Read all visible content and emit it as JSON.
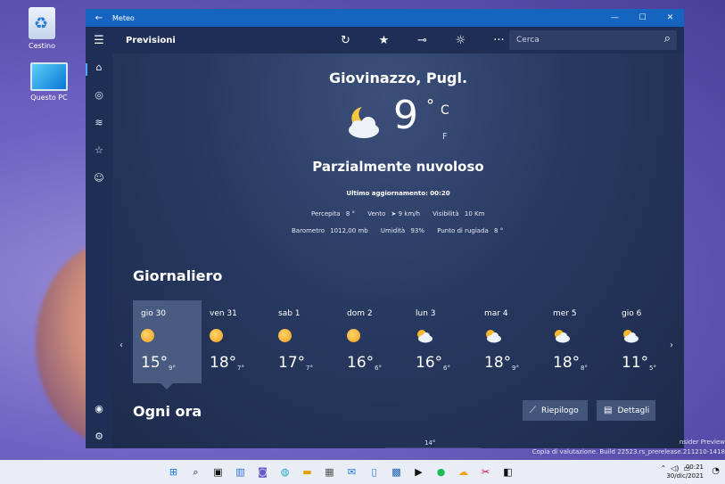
{
  "desktop": {
    "icons": [
      {
        "label": "Cestino",
        "icon": "recycle-bin-icon"
      },
      {
        "label": "Questo PC",
        "icon": "computer-icon"
      }
    ],
    "watermark_line1": "nsider Preview",
    "watermark_line2": "Copia di valutazione. Build 22523.rs_prerelease.211210-1418"
  },
  "window": {
    "title": "Meteo",
    "back_icon": "back-arrow-icon",
    "controls": [
      "minimize-icon",
      "maximize-icon",
      "close-icon"
    ]
  },
  "toolbar": {
    "title": "Previsioni",
    "actions": [
      "refresh-icon",
      "favorite-star-icon",
      "pin-icon",
      "settings-sun-icon",
      "more-icon"
    ],
    "search_placeholder": "Cerca"
  },
  "nav": {
    "items": [
      "home-icon",
      "radar-icon",
      "historical-chart-icon",
      "favorites-icon",
      "life-icon",
      "account-icon",
      "settings-gear-icon"
    ]
  },
  "current": {
    "location": "Giovinazzo, Pugl.",
    "temperature": "9",
    "degree": "°",
    "unit_c": "C",
    "unit_f": "F",
    "condition": "Parzialmente nuvoloso",
    "updated": "Ultimo aggiornamento: 00:20",
    "feels_label": "Percepita",
    "feels_value": "8 °",
    "wind_label": "Vento",
    "wind_value": "➤ 9 km/h",
    "visibility_label": "Visibilità",
    "visibility_value": "10 Km",
    "pressure_label": "Barometro",
    "pressure_value": "1012,00 mb",
    "humidity_label": "Umidità",
    "humidity_value": "93%",
    "dew_label": "Punto di rugiada",
    "dew_value": "8 °"
  },
  "daily": {
    "title": "Giornaliero",
    "days": [
      {
        "name": "gio 30",
        "hi": "15°",
        "lo": "9°",
        "icon": "sun-icon"
      },
      {
        "name": "ven 31",
        "hi": "18°",
        "lo": "7°",
        "icon": "sun-icon"
      },
      {
        "name": "sab 1",
        "hi": "17°",
        "lo": "7°",
        "icon": "sun-icon"
      },
      {
        "name": "dom 2",
        "hi": "16°",
        "lo": "6°",
        "icon": "sun-icon"
      },
      {
        "name": "lun 3",
        "hi": "16°",
        "lo": "6°",
        "icon": "partly-cloudy-icon"
      },
      {
        "name": "mar 4",
        "hi": "18°",
        "lo": "9°",
        "icon": "partly-cloudy-icon"
      },
      {
        "name": "mer 5",
        "hi": "18°",
        "lo": "8°",
        "icon": "partly-cloudy-icon"
      },
      {
        "name": "gio 6",
        "hi": "11°",
        "lo": "5°",
        "icon": "partly-cloudy-icon"
      }
    ]
  },
  "hourly": {
    "title": "Ogni ora",
    "summary_button": "Riepilogo",
    "details_button": "Dettagli",
    "first_temp": "14°"
  },
  "taskbar": {
    "apps": [
      "start-icon",
      "search-icon",
      "task-view-icon",
      "widgets-icon",
      "chat-icon",
      "edge-icon",
      "file-explorer-icon",
      "store-icon",
      "mail-icon",
      "phone-icon",
      "photos-icon",
      "media-player-icon",
      "spotify-icon",
      "weather-icon",
      "snip-icon",
      "office-icon"
    ],
    "time": "00:21",
    "date": "30/dic/2021"
  }
}
